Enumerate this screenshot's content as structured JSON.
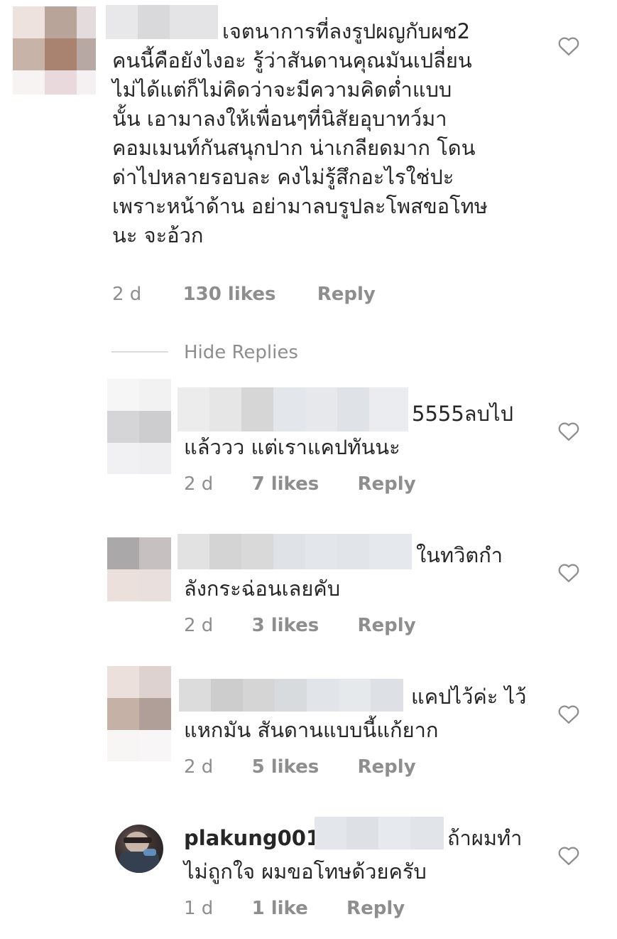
{
  "comments": [
    {
      "text_line1": "เจตนาการที่ลงรูปผญกับผช2",
      "text_rest": [
        "คนนี้คือยังไงอะ รู้ว่าสันดานคุณมันเปลี่ยน",
        "ไม่ได้แต่ก็ไม่คิดว่าจะมีความคิดต่ำแบบ",
        "นั้น เอามาลงให้เพื่อนๆที่นิสัยอุบาทว์มา",
        "คอมเมนท์กันสนุกปาก น่าเกลียดมาก โดน",
        "ด่าไปหลายรอบละ คงไม่รู้สึกอะไรใช่ปะ",
        "เพราะหน้าด้าน อย่ามาลบรูปละโพสขอโทษ",
        "นะ จะอ้วก"
      ],
      "time": "2 d",
      "likes": "130 likes",
      "reply": "Reply"
    }
  ],
  "hide_replies": "Hide Replies",
  "replies": [
    {
      "text_line1": "5555ลบไป",
      "text_line2": "แล้ววว แต่เราแคปทันนะ",
      "time": "2 d",
      "likes": "7 likes",
      "reply": "Reply"
    },
    {
      "text_line1": "ในทวิตกำ",
      "text_line2": "ลังกระฉ่อนเลยคับ",
      "time": "2 d",
      "likes": "3 likes",
      "reply": "Reply"
    },
    {
      "text_line1": "แคปไว้ค่ะ ไว้",
      "text_line2": "แหกมัน สันดานแบบนี้แก้ยาก",
      "time": "2 d",
      "likes": "5 likes",
      "reply": "Reply"
    },
    {
      "username": "plakung001",
      "text_line1": "ถ้าผมทำ",
      "text_line2": "ไม่ถูกใจ ผมขอโทษด้วยครับ",
      "time": "1 d",
      "likes": "1 like",
      "reply": "Reply"
    }
  ],
  "icons": {
    "heart": "heart-outline-icon"
  },
  "colors": {
    "text": "#262626",
    "meta": "#8e8e8e",
    "heart": "#8e8e8e"
  }
}
